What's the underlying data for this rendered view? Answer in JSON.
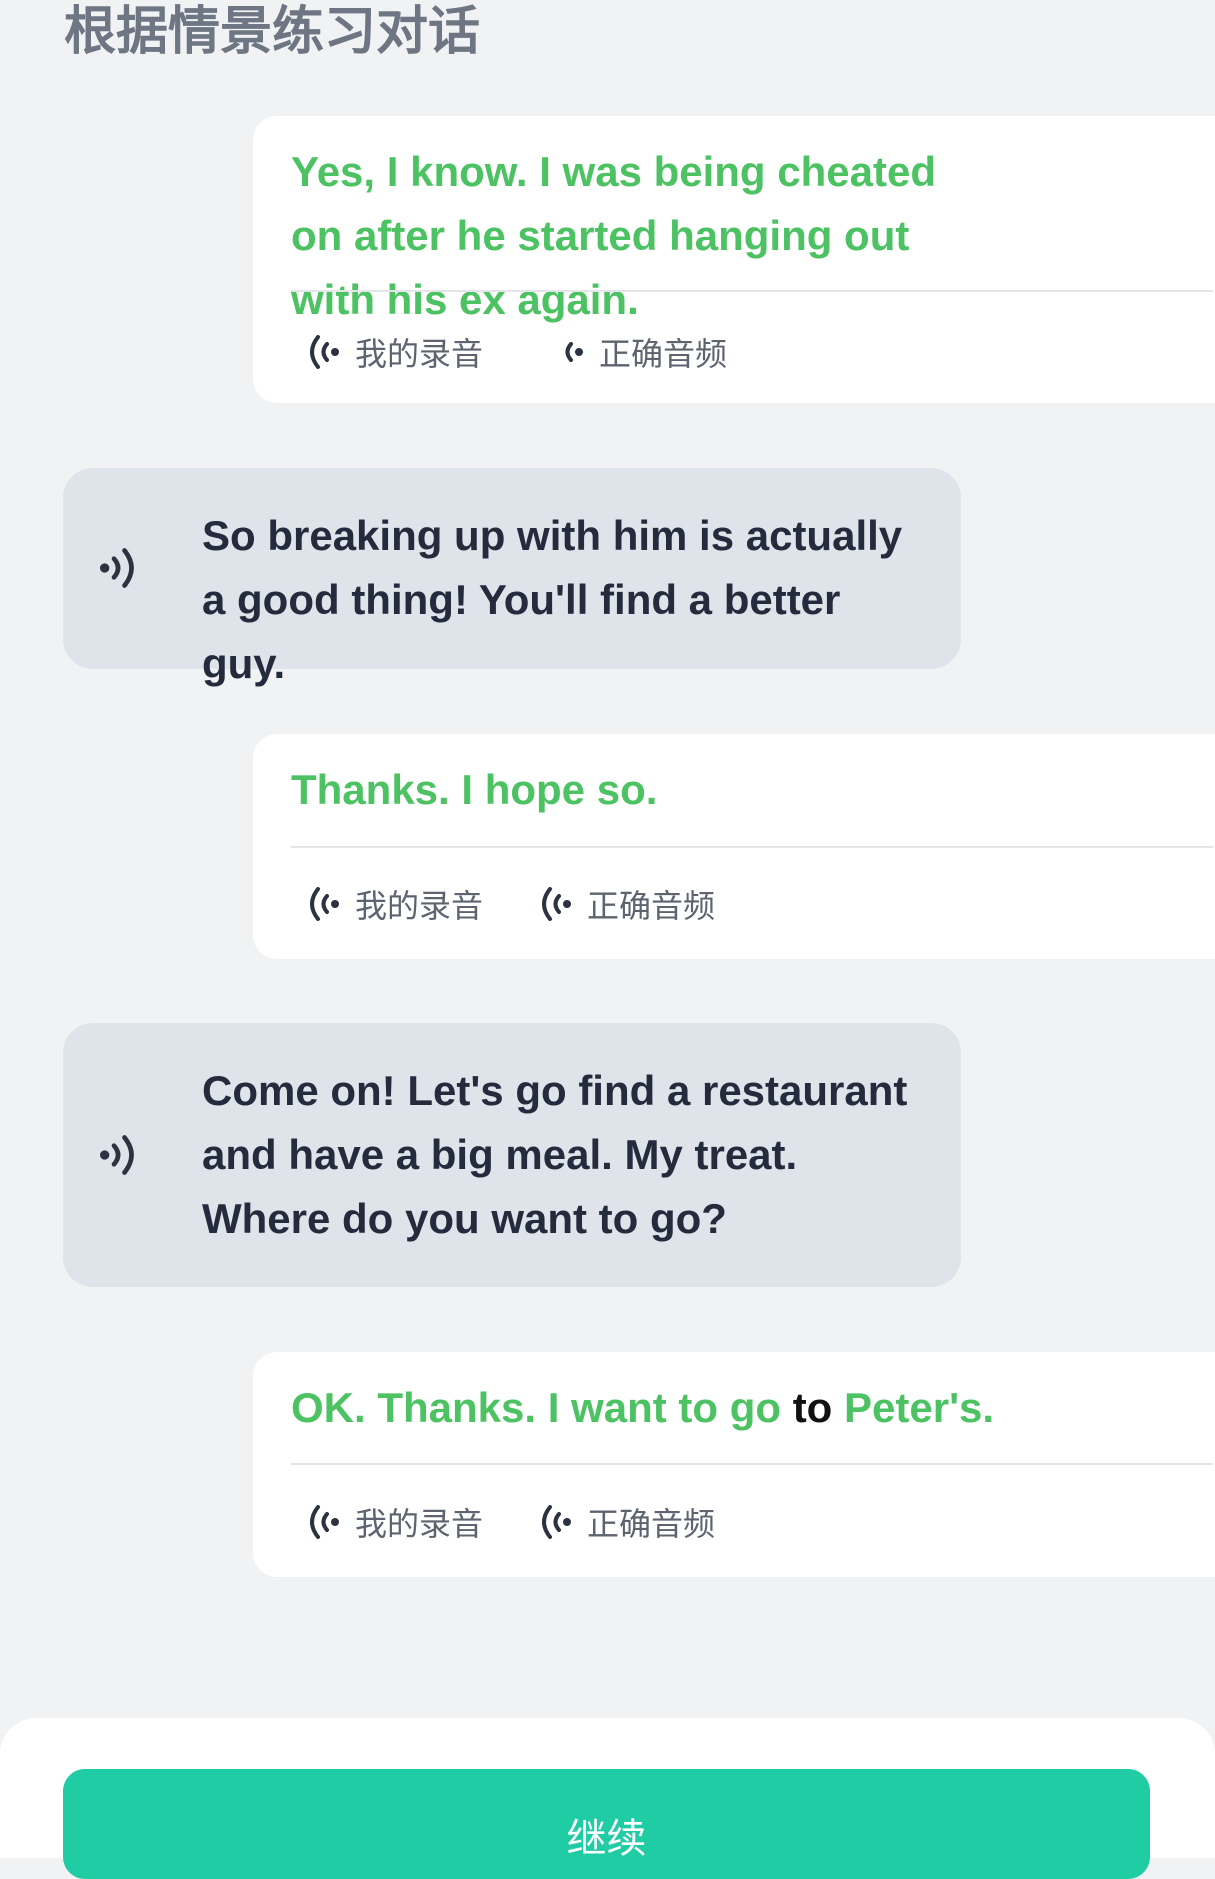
{
  "page": {
    "title": "根据情景练习对话"
  },
  "colors": {
    "background": "#f1f2f4",
    "user_text": "#4cc263",
    "bot_bubble": "#dfe3ea",
    "bot_text": "#232b3c",
    "continue_button": "#1fcca3"
  },
  "audio_labels": {
    "my_recording": "我的录音",
    "correct_audio": "正确音频"
  },
  "messages": [
    {
      "role": "user",
      "text": "Yes, I know. I was being cheated on after he started hanging out with his ex again.",
      "icons": [
        "recording-wave-icon",
        "audio-wave-icon"
      ]
    },
    {
      "role": "bot",
      "text": "So breaking up with him is actually a good thing! You'll find a better guy.",
      "icon": "speaker-icon"
    },
    {
      "role": "user",
      "text": "Thanks. I hope so.",
      "icons": [
        "recording-wave-icon",
        "audio-wave-icon"
      ]
    },
    {
      "role": "bot",
      "text": "Come on! Let's go find a restaurant and have a big meal. My treat. Where do you want to go?",
      "icon": "speaker-icon"
    },
    {
      "role": "user",
      "text_parts": [
        "OK. Thanks. I want to go ",
        "to",
        " Peter's."
      ],
      "icons": [
        "recording-wave-icon",
        "audio-wave-icon"
      ]
    }
  ],
  "footer": {
    "continue_label": "继续"
  }
}
